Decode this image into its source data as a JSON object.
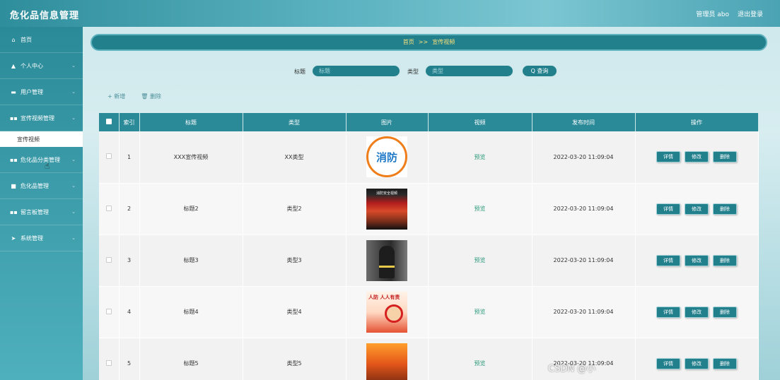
{
  "header": {
    "app_title": "危化品信息管理",
    "user_label": "管理员 abo",
    "logout_label": "退出登录"
  },
  "sidebar": {
    "items": [
      {
        "label": "首页",
        "icon": "home-icon",
        "glyph": "⌂"
      },
      {
        "label": "个人中心",
        "icon": "user-icon",
        "glyph": "▲"
      },
      {
        "label": "用户管理",
        "icon": "monitor-icon",
        "glyph": "▬"
      },
      {
        "label": "宣传视频管理",
        "icon": "grid-icon",
        "glyph": "▪▪"
      },
      {
        "label": "危化品分类管理",
        "icon": "grid-icon",
        "glyph": "▪▪"
      },
      {
        "label": "危化品管理",
        "icon": "lock-icon",
        "glyph": "■"
      },
      {
        "label": "留言板管理",
        "icon": "grid-icon",
        "glyph": "▪▪"
      },
      {
        "label": "系统管理",
        "icon": "send-icon",
        "glyph": "➤"
      }
    ],
    "subitem": "宣传视频"
  },
  "breadcrumb": {
    "home": "首页",
    "separator": ">>",
    "current": "宣传视频"
  },
  "search": {
    "title_label": "标题",
    "title_placeholder": "标题",
    "type_label": "类型",
    "type_placeholder": "类型",
    "button_label": "Q 查询"
  },
  "actions": {
    "add": "+ 新增",
    "delete": "🗑 删除"
  },
  "table": {
    "headers": [
      "",
      "索引",
      "标题",
      "类型",
      "图片",
      "视频",
      "发布时间",
      "操作"
    ],
    "rows": [
      {
        "index": "1",
        "title": "XXX宣传视频",
        "type": "XX类型",
        "video": "预览",
        "time": "2022-03-20 11:09:04"
      },
      {
        "index": "2",
        "title": "标题2",
        "type": "类型2",
        "video": "预览",
        "time": "2022-03-20 11:09:04"
      },
      {
        "index": "3",
        "title": "标题3",
        "type": "类型3",
        "video": "预览",
        "time": "2022-03-20 11:09:04"
      },
      {
        "index": "4",
        "title": "标题4",
        "type": "类型4",
        "video": "预览",
        "time": "2022-03-20 11:09:04"
      },
      {
        "index": "5",
        "title": "标题5",
        "type": "类型5",
        "video": "预览",
        "time": "2022-03-20 11:09:04"
      }
    ],
    "op_labels": {
      "detail": "详情",
      "edit": "修改",
      "delete": "删除"
    },
    "thumb_texts": {
      "t1": "消防",
      "t2": "消防安全视频",
      "t4": "人防 人人有责"
    }
  },
  "watermark": "CSDN @小",
  "colors": {
    "accent": "#227f8c",
    "header": "#2f8e9c",
    "crumb_text": "#f7e27a",
    "preview": "#2a9a7a"
  }
}
